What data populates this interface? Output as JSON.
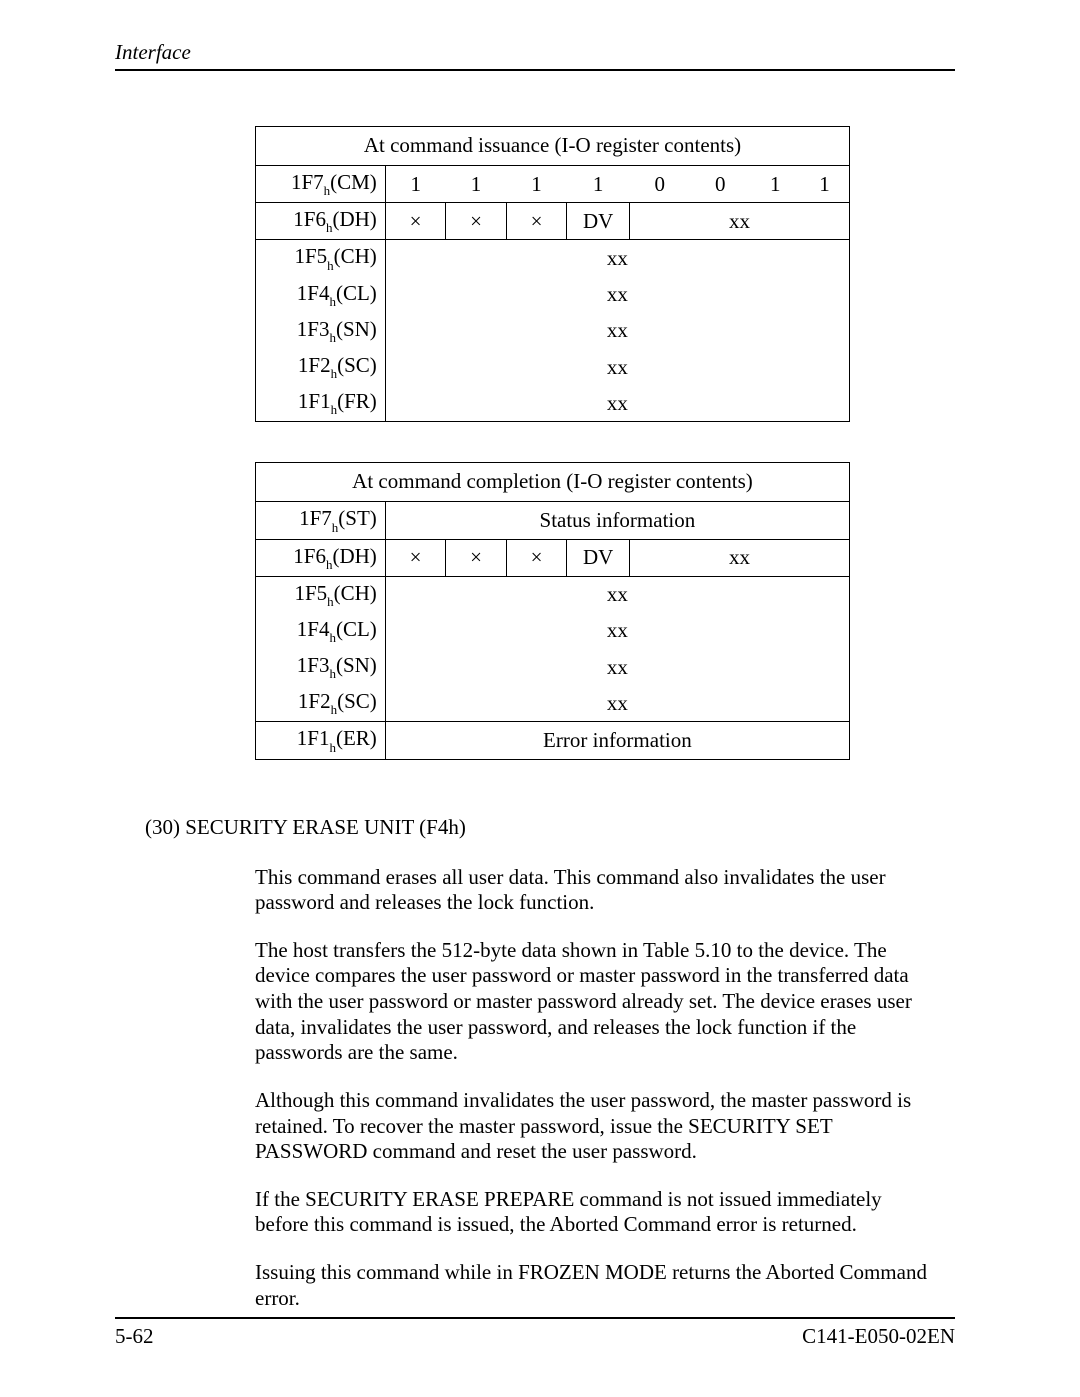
{
  "running_head": "Interface",
  "table1": {
    "title": "At command issuance (I-O register contents)",
    "rows": {
      "r1": {
        "label_main": "1F7",
        "label_sub": "h",
        "label_suffix": "(CM)",
        "b": [
          "1",
          "1",
          "1",
          "1",
          "0",
          "0",
          "1",
          "1"
        ]
      },
      "r2": {
        "label_main": "1F6",
        "label_sub": "h",
        "label_suffix": "(DH)",
        "b": [
          "×",
          "×",
          "×",
          "DV",
          "xx",
          "",
          "",
          ""
        ]
      },
      "r3": {
        "label_main": "1F5",
        "label_sub": "h",
        "label_suffix": "(CH)",
        "span": "xx"
      },
      "r4": {
        "label_main": "1F4",
        "label_sub": "h",
        "label_suffix": "(CL)",
        "span": "xx"
      },
      "r5": {
        "label_main": "1F3",
        "label_sub": "h",
        "label_suffix": "(SN)",
        "span": "xx"
      },
      "r6": {
        "label_main": "1F2",
        "label_sub": "h",
        "label_suffix": "(SC)",
        "span": "xx"
      },
      "r7": {
        "label_main": "1F1",
        "label_sub": "h",
        "label_suffix": "(FR)",
        "span": "xx"
      }
    }
  },
  "table2": {
    "title": "At command completion (I-O register contents)",
    "rows": {
      "r1": {
        "label_main": "1F7",
        "label_sub": "h",
        "label_suffix": "(ST)",
        "span": "Status information"
      },
      "r2": {
        "label_main": "1F6",
        "label_sub": "h",
        "label_suffix": "(DH)",
        "b": [
          "×",
          "×",
          "×",
          "DV",
          "xx",
          "",
          "",
          ""
        ]
      },
      "r3": {
        "label_main": "1F5",
        "label_sub": "h",
        "label_suffix": "(CH)",
        "span": "xx"
      },
      "r4": {
        "label_main": "1F4",
        "label_sub": "h",
        "label_suffix": "(CL)",
        "span": "xx"
      },
      "r5": {
        "label_main": "1F3",
        "label_sub": "h",
        "label_suffix": "(SN)",
        "span": "xx"
      },
      "r6": {
        "label_main": "1F2",
        "label_sub": "h",
        "label_suffix": "(SC)",
        "span": "xx"
      },
      "r7": {
        "label_main": "1F1",
        "label_sub": "h",
        "label_suffix": "(ER)",
        "span": "Error information"
      }
    }
  },
  "section_title": "(30)  SECURITY ERASE UNIT (F4h)",
  "paras": {
    "p1": "This command erases all user data.  This command also invalidates the user password and releases the lock function.",
    "p2": "The host transfers the 512-byte data shown in Table 5.10 to the device.  The device compares the user password or master password in the transferred data with the user password or master password already set.  The device erases user data, invalidates the user password, and releases the lock function if the passwords are the same.",
    "p3": "Although this command invalidates the user password, the master password is retained.  To recover the master password, issue the SECURITY SET PASSWORD command and reset the user password.",
    "p4": "If the SECURITY ERASE PREPARE command is not issued immediately before this command is issued, the Aborted Command error is returned.",
    "p5": "Issuing this command while in FROZEN MODE returns the Aborted Command error."
  },
  "footer": {
    "left": "5-62",
    "right": "C141-E050-02EN"
  }
}
